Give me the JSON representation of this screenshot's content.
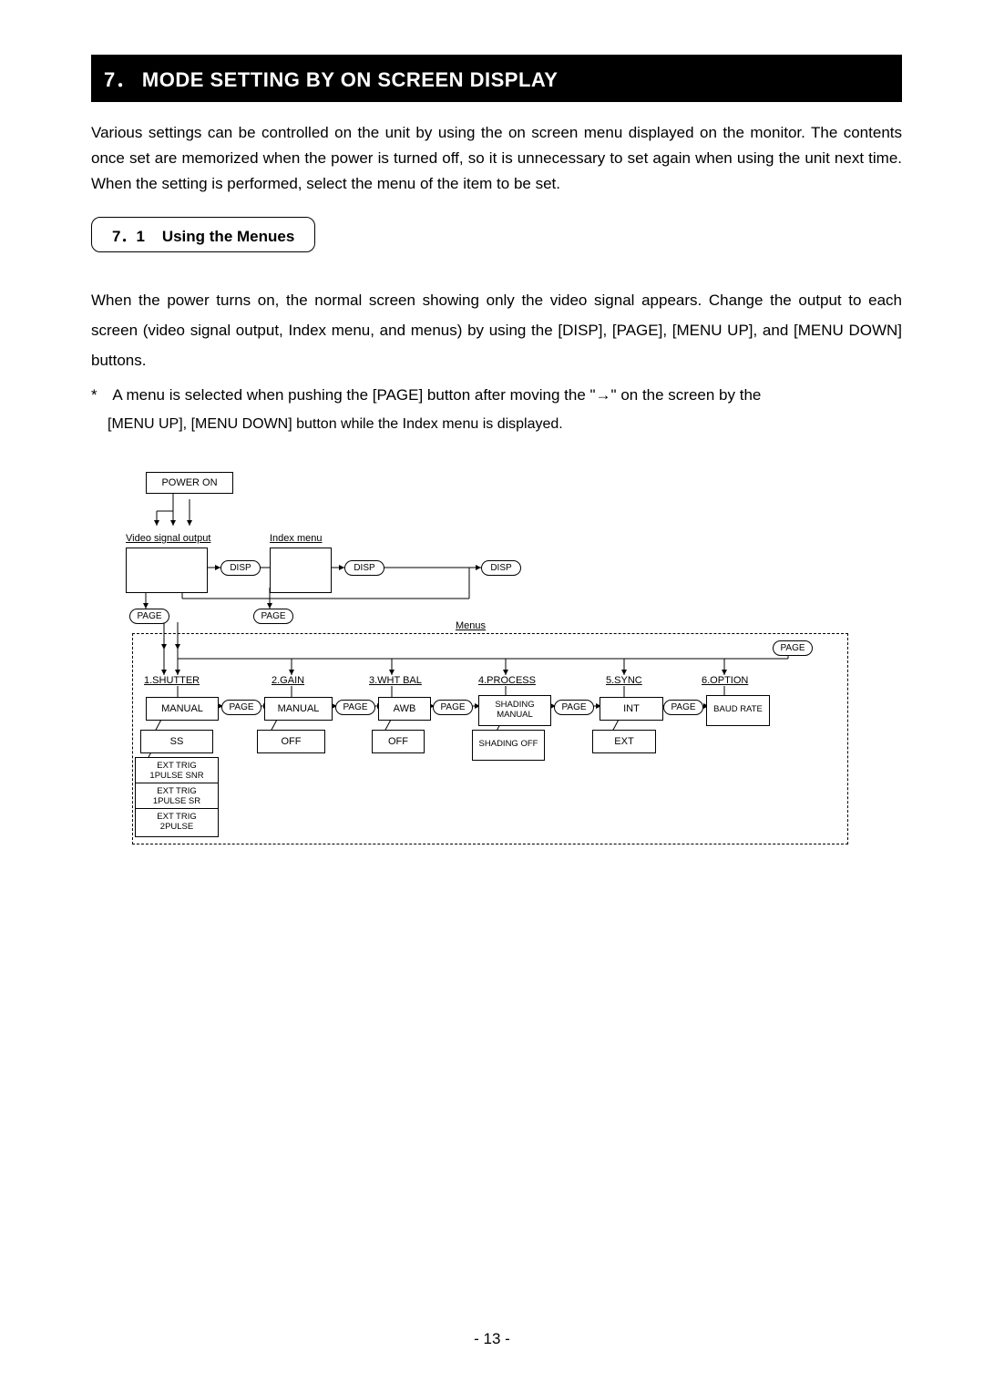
{
  "section": {
    "number": "7．",
    "title": "MODE SETTING BY ON SCREEN DISPLAY"
  },
  "intro": "Various settings can be controlled on the unit by using the on screen menu displayed on the monitor. The contents once set are memorized when the power is turned off, so it is unnecessary to set again when using the unit next time. When the setting is performed, select the menu of the item to be set.",
  "subsection": {
    "number": "7．1",
    "title": "Using the Menues"
  },
  "body1": "When the power turns on, the normal screen showing only the video signal appears. Change the output to each screen (video signal output, Index menu, and menus) by using the [DISP], [PAGE], [MENU UP], and [MENU DOWN] buttons.",
  "note_star": "*",
  "note_text": "A menu is selected when pushing the [PAGE] button after moving the \"→\" on the screen by the [MENU UP], [MENU DOWN] button while the Index menu is displayed.",
  "diagram": {
    "power_on": "POWER ON",
    "video_out": "Video signal output",
    "index_menu": "Index menu",
    "disp": "DISP",
    "page": "PAGE",
    "menus": "Menus",
    "menu_headers": {
      "1": "1.SHUTTER",
      "2": "2.GAIN",
      "3": "3.WHT BAL",
      "4": "4.PROCESS",
      "5": "5.SYNC",
      "6": "6.OPTION"
    },
    "col1": {
      "a": "MANUAL",
      "b": "SS",
      "c": "EXT TRIG 1PULSE SNR",
      "d": "EXT TRIG 1PULSE SR",
      "e": "EXT TRIG 2PULSE"
    },
    "col2": {
      "a": "MANUAL",
      "b": "OFF"
    },
    "col3": {
      "a": "AWB",
      "b": "OFF"
    },
    "col4": {
      "a": "SHADING MANUAL",
      "b": "SHADING OFF"
    },
    "col5": {
      "a": "INT",
      "b": "EXT"
    },
    "col6": {
      "a": "BAUD RATE"
    }
  },
  "page_number": "- 13 -"
}
